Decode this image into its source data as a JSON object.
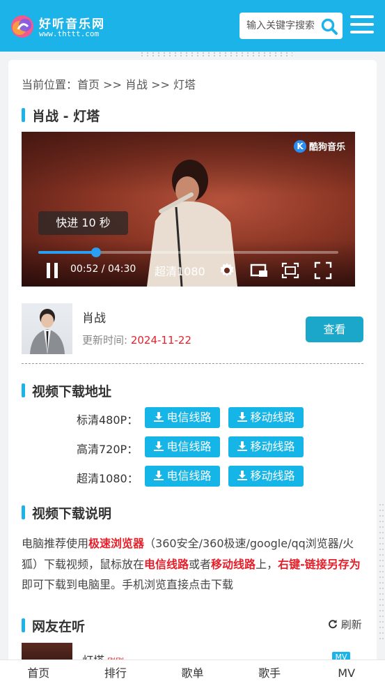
{
  "header": {
    "logo_title": "好听音乐网",
    "logo_sub": "www.thttt.com",
    "search_placeholder": "输入关键字搜索"
  },
  "breadcrumb": {
    "prefix": "当前位置：",
    "home": "首页",
    "sep": " >> ",
    "category": "肖战",
    "current": "灯塔"
  },
  "song": {
    "title": "肖战 - 灯塔"
  },
  "player": {
    "watermark": "酷狗音乐",
    "seek_tip": "快进 10 秒",
    "current_time": "00:52",
    "duration": "04:30",
    "time_display": "00:52 / 04:30",
    "quality": "超清1080",
    "progress": 0.193
  },
  "artist": {
    "name": "肖战",
    "update_label": "更新时间: ",
    "update_date": "2024-11-22",
    "view_button": "查看"
  },
  "download": {
    "section_title": "视频下载地址",
    "rows": [
      {
        "label": "标清480P：",
        "telecom": "电信线路",
        "mobile": "移动线路"
      },
      {
        "label": "高清720P：",
        "telecom": "电信线路",
        "mobile": "移动线路"
      },
      {
        "label": "超清1080：",
        "telecom": "电信线路",
        "mobile": "移动线路"
      }
    ]
  },
  "instructions": {
    "section_title": "视频下载说明",
    "p1": "电脑推荐使用",
    "browser": "极速浏览器",
    "p2": "（360安全/360极速/google/qq浏览器/火狐）下载视频，鼠标放在",
    "telecom": "电信线路",
    "p3": "或者",
    "mobile": "移动线路",
    "p4": "上，",
    "save_as": "右键-链接另存为",
    "p5": "即可下载到电脑里。手机浏览直接点击下载"
  },
  "listening": {
    "section_title": "网友在听",
    "refresh": "刷新",
    "items": [
      {
        "title": "灯塔",
        "tag": "刚刚",
        "badge": "MV"
      }
    ]
  },
  "bottom_nav": [
    "首页",
    "排行",
    "歌单",
    "歌手",
    "MV"
  ],
  "colors": {
    "brand": "#1bb3e8",
    "accent_red": "#e5202a",
    "view_button": "#1aa7c9"
  }
}
